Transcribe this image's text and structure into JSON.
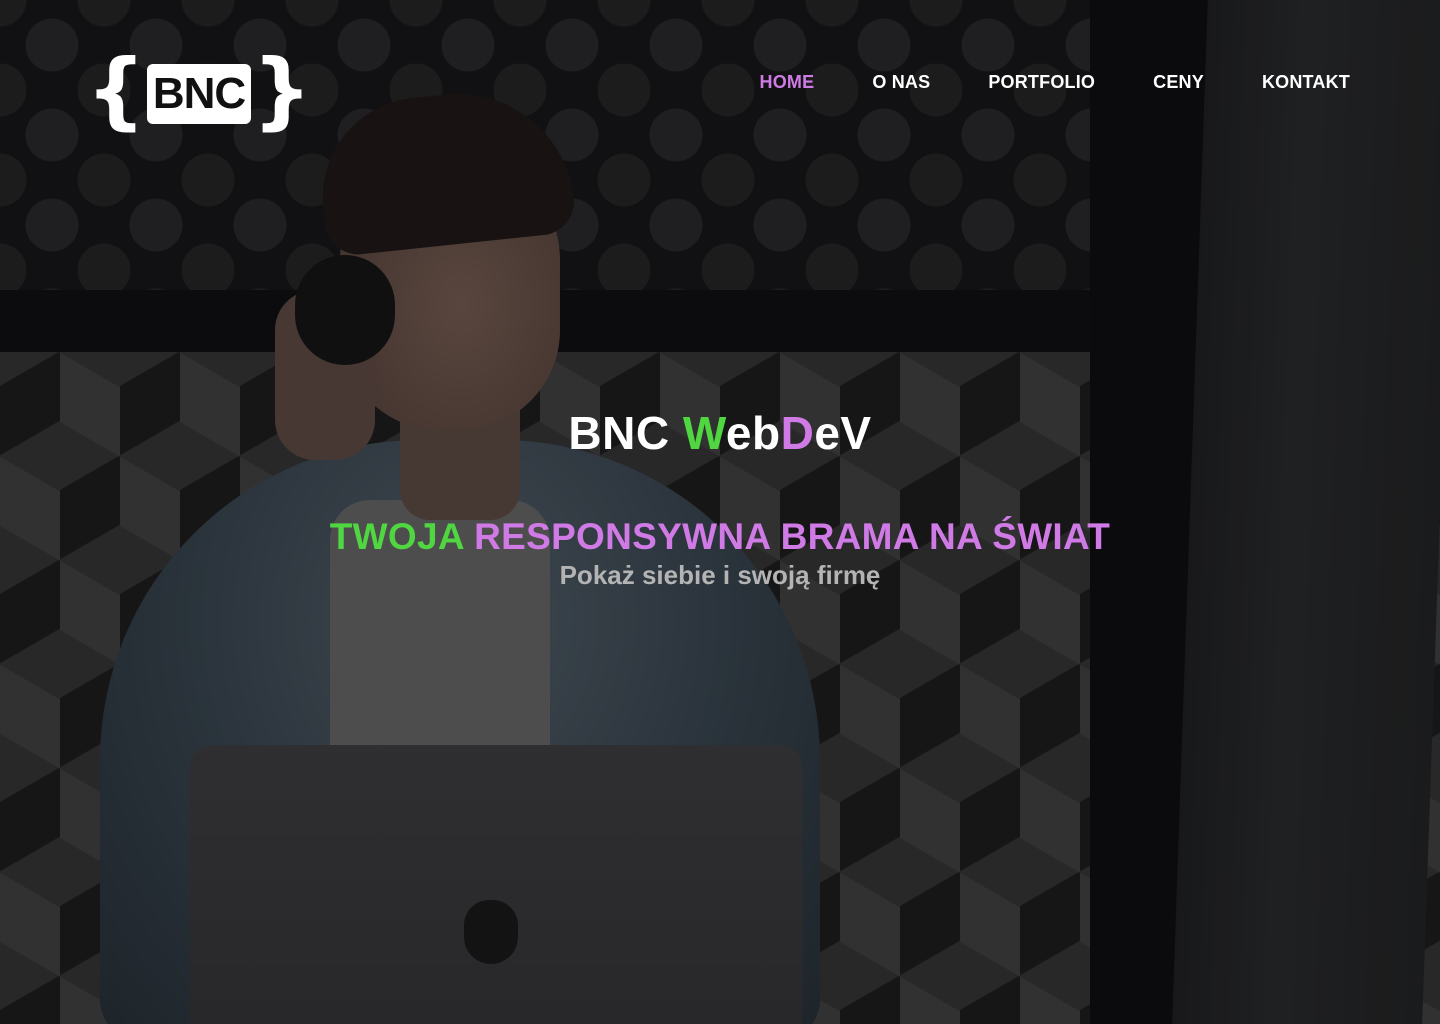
{
  "logo": {
    "text": "BNC",
    "brace_open": "{",
    "brace_close": "}"
  },
  "nav": {
    "items": [
      {
        "label": "HOME",
        "active": true
      },
      {
        "label": "O NAS",
        "active": false
      },
      {
        "label": "PORTFOLIO",
        "active": false
      },
      {
        "label": "CENY",
        "active": false
      },
      {
        "label": "KONTAKT",
        "active": false
      }
    ]
  },
  "hero": {
    "title_part1": "BNC ",
    "title_w": "W",
    "title_eb": "eb",
    "title_d": "D",
    "title_ev": "eV",
    "tagline_green": "TWOJA",
    "tagline_rest": " RESPONSYWNA BRAMA NA ŚWIAT",
    "subtitle": "Pokaż siebie i swoją firmę"
  },
  "colors": {
    "accent_purple": "#d07ae6",
    "accent_green": "#4fd640",
    "nav_text": "#ffffff",
    "subtitle_text": "#b4b4b4"
  },
  "images": {
    "background": "photo-man-with-headphones-and-laptop"
  }
}
